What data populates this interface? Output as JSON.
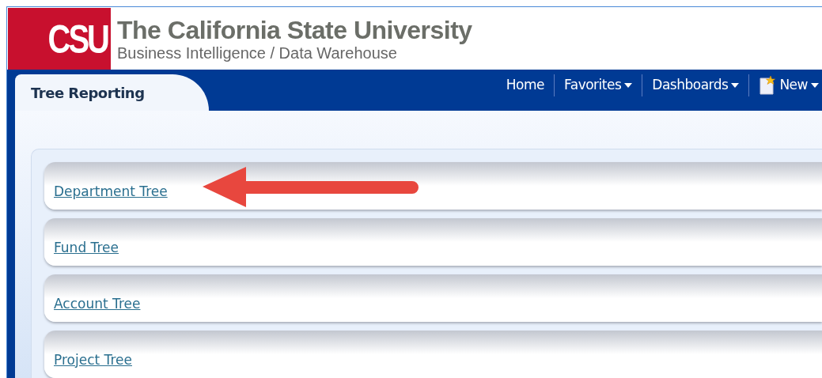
{
  "header": {
    "logo": "CSU",
    "title": "The California State University",
    "subtitle": "Business Intelligence / Data Warehouse"
  },
  "tab": {
    "label": "Tree Reporting",
    "selected": true
  },
  "nav": [
    {
      "label": "Home",
      "kind": "plain"
    },
    {
      "label": "Favorites",
      "kind": "menu"
    },
    {
      "label": "Dashboards",
      "kind": "menu"
    },
    {
      "label": "New",
      "kind": "new"
    }
  ],
  "links": [
    {
      "label": "Department Tree",
      "highlighted": true
    },
    {
      "label": "Fund Tree",
      "highlighted": false
    },
    {
      "label": "Account Tree",
      "highlighted": false
    },
    {
      "label": "Project Tree",
      "highlighted": false
    }
  ]
}
